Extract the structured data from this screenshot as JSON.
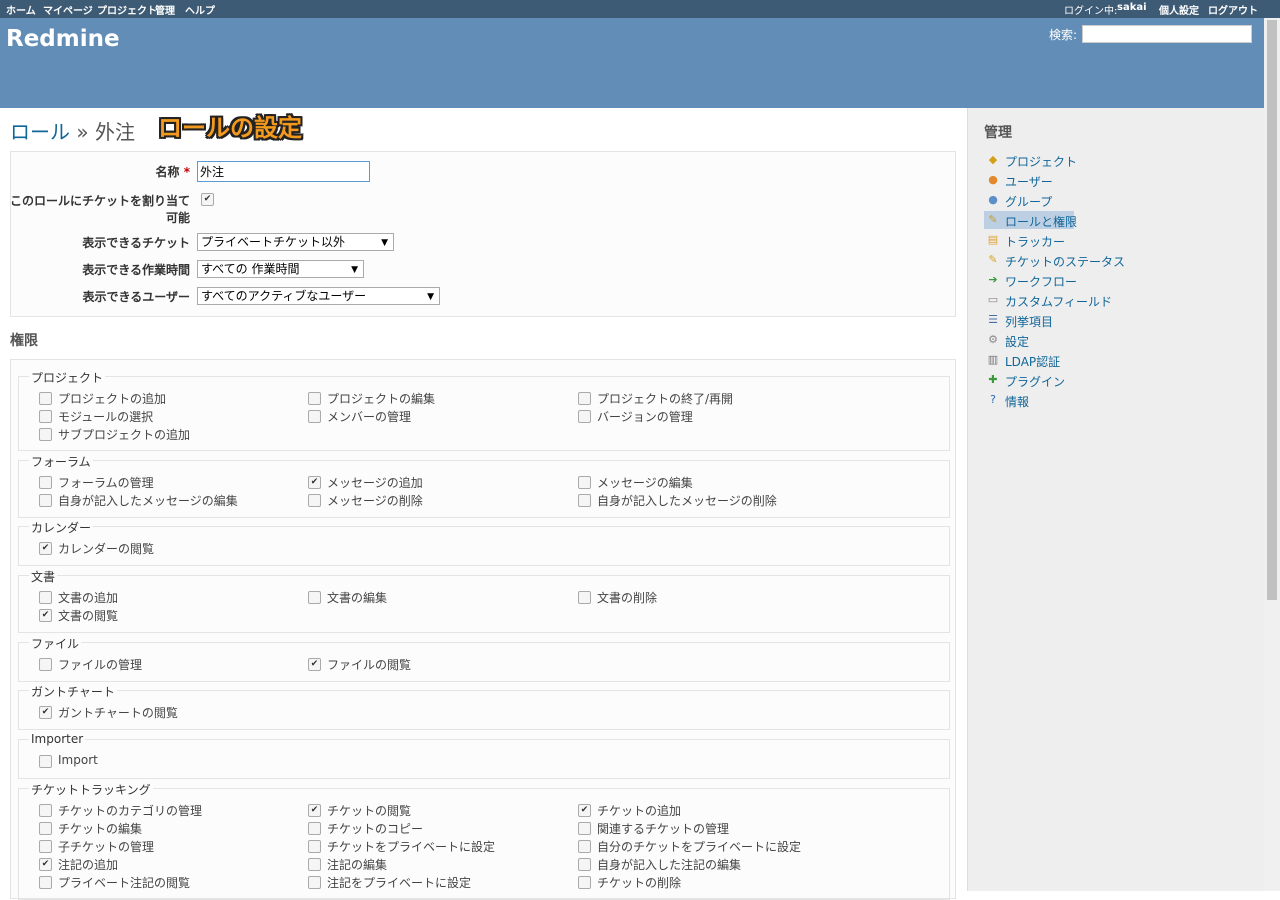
{
  "top_menu": {
    "items": [
      "ホーム",
      "マイページ",
      "プロジェクト",
      "管理",
      "ヘルプ"
    ],
    "login_prefix": "ログイン中: ",
    "login_user": "sakai",
    "account": "個人設定",
    "logout": "ログアウト"
  },
  "header": {
    "title": "Redmine",
    "search_label": "検索:",
    "search_value": ""
  },
  "breadcrumb": {
    "root": "ロール",
    "sep": " » ",
    "current": "外注"
  },
  "annotation": "ロールの設定",
  "form": {
    "name_label": "名称",
    "required_mark": "*",
    "name_value": "外注",
    "assignable_label_1": "このロールにチケットを割り当て",
    "assignable_label_2": "可能",
    "assignable_checked": true,
    "issues_visibility_label": "表示できるチケット",
    "issues_visibility_value": "プライベートチケット以外",
    "time_visibility_label": "表示できる作業時間",
    "time_visibility_value": "すべての 作業時間",
    "users_visibility_label": "表示できるユーザー",
    "users_visibility_value": "すべてのアクティブなユーザー"
  },
  "permissions": {
    "title": "権限",
    "groups": [
      {
        "name": "プロジェクト",
        "items": [
          {
            "label": "プロジェクトの追加",
            "checked": false
          },
          {
            "label": "プロジェクトの編集",
            "checked": false
          },
          {
            "label": "プロジェクトの終了/再開",
            "checked": false
          },
          {
            "label": "モジュールの選択",
            "checked": false
          },
          {
            "label": "メンバーの管理",
            "checked": false
          },
          {
            "label": "バージョンの管理",
            "checked": false
          },
          {
            "label": "サブプロジェクトの追加",
            "checked": false
          }
        ]
      },
      {
        "name": "フォーラム",
        "items": [
          {
            "label": "フォーラムの管理",
            "checked": false
          },
          {
            "label": "メッセージの追加",
            "checked": true
          },
          {
            "label": "メッセージの編集",
            "checked": false
          },
          {
            "label": "自身が記入したメッセージの編集",
            "checked": false
          },
          {
            "label": "メッセージの削除",
            "checked": false
          },
          {
            "label": "自身が記入したメッセージの削除",
            "checked": false
          }
        ]
      },
      {
        "name": "カレンダー",
        "items": [
          {
            "label": "カレンダーの閲覧",
            "checked": true
          }
        ]
      },
      {
        "name": "文書",
        "items": [
          {
            "label": "文書の追加",
            "checked": false
          },
          {
            "label": "文書の編集",
            "checked": false
          },
          {
            "label": "文書の削除",
            "checked": false
          },
          {
            "label": "文書の閲覧",
            "checked": true
          }
        ]
      },
      {
        "name": "ファイル",
        "items": [
          {
            "label": "ファイルの管理",
            "checked": false
          },
          {
            "label": "ファイルの閲覧",
            "checked": true
          }
        ]
      },
      {
        "name": "ガントチャート",
        "items": [
          {
            "label": "ガントチャートの閲覧",
            "checked": true
          }
        ]
      },
      {
        "name": "Importer",
        "items": [
          {
            "label": "Import",
            "checked": false
          }
        ]
      },
      {
        "name": "チケットトラッキング",
        "items": [
          {
            "label": "チケットのカテゴリの管理",
            "checked": false
          },
          {
            "label": "チケットの閲覧",
            "checked": true
          },
          {
            "label": "チケットの追加",
            "checked": true
          },
          {
            "label": "チケットの編集",
            "checked": false
          },
          {
            "label": "チケットのコピー",
            "checked": false
          },
          {
            "label": "関連するチケットの管理",
            "checked": false
          },
          {
            "label": "子チケットの管理",
            "checked": false
          },
          {
            "label": "チケットをプライベートに設定",
            "checked": false
          },
          {
            "label": "自分のチケットをプライベートに設定",
            "checked": false
          },
          {
            "label": "注記の追加",
            "checked": true
          },
          {
            "label": "注記の編集",
            "checked": false
          },
          {
            "label": "自身が記入した注記の編集",
            "checked": false
          },
          {
            "label": "プライベート注記の閲覧",
            "checked": false
          },
          {
            "label": "注記をプライベートに設定",
            "checked": false
          },
          {
            "label": "チケットの削除",
            "checked": false
          }
        ]
      }
    ]
  },
  "sidebar": {
    "title": "管理",
    "items": [
      {
        "label": "プロジェクト",
        "icon": "projects-icon",
        "glyph": "◆",
        "color": "#d4a017"
      },
      {
        "label": "ユーザー",
        "icon": "user-icon",
        "glyph": "●",
        "color": "#e08a2c"
      },
      {
        "label": "グループ",
        "icon": "group-icon",
        "glyph": "●",
        "color": "#5a8fc8"
      },
      {
        "label": "ロールと権限",
        "icon": "role-key-icon",
        "glyph": "✎",
        "color": "#c99b2a",
        "selected": true
      },
      {
        "label": "トラッカー",
        "icon": "tracker-icon",
        "glyph": "▤",
        "color": "#e0a030"
      },
      {
        "label": "チケットのステータス",
        "icon": "status-icon",
        "glyph": "✎",
        "color": "#d9a520"
      },
      {
        "label": "ワークフロー",
        "icon": "workflow-icon",
        "glyph": "➔",
        "color": "#3a9a3a"
      },
      {
        "label": "カスタムフィールド",
        "icon": "custom-field-icon",
        "glyph": "▭",
        "color": "#888888"
      },
      {
        "label": "列挙項目",
        "icon": "list-icon",
        "glyph": "☰",
        "color": "#4a6fa5"
      },
      {
        "label": "設定",
        "icon": "gear-icon",
        "glyph": "⚙",
        "color": "#888888"
      },
      {
        "label": "LDAP認証",
        "icon": "server-icon",
        "glyph": "▥",
        "color": "#777777"
      },
      {
        "label": "プラグイン",
        "icon": "plugin-icon",
        "glyph": "✚",
        "color": "#3a9a3a"
      },
      {
        "label": "情報",
        "icon": "info-icon",
        "glyph": "?",
        "color": "#2a6ab0"
      }
    ]
  }
}
